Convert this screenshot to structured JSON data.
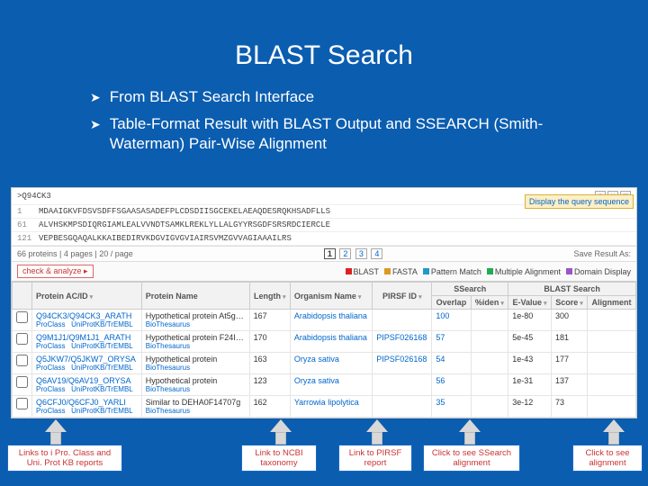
{
  "title": "BLAST Search",
  "bullets": [
    "From BLAST Search Interface",
    "Table-Format Result with BLAST Output and SSEARCH (Smith-Waterman) Pair-Wise Alignment"
  ],
  "seq": {
    "header": ">Q94CK3",
    "rows": [
      {
        "n": "1",
        "s": "MDAAIGKVFDSVSDFFSGAASASADEFPLCDSDIISGCEKELAEAQDESRQKHSADFLLS"
      },
      {
        "n": "61",
        "s": "ALVHSKMPSDIQRGIAMLEALVVNDTSAMKLREKLYLLALGYYRSGDFSRSRDCIERCLE"
      },
      {
        "n": "121",
        "s": "VEPBESGQAQALKKAIBEDIRVKDGVIGVGVIAIRSVMZGVVAGIAAAILRS"
      }
    ]
  },
  "pager": {
    "summary": "66 proteins | 4 pages | 20 / page",
    "pages": [
      "1",
      "2",
      "3",
      "4"
    ],
    "save": "Save Result As:"
  },
  "action": {
    "check": "check & analyze ▸",
    "legend": [
      {
        "c": "#d22",
        "t": "BLAST"
      },
      {
        "c": "#d92",
        "t": "FASTA"
      },
      {
        "c": "#29c",
        "t": "Pattern Match"
      },
      {
        "c": "#2a5",
        "t": "Multiple Alignment"
      },
      {
        "c": "#95c",
        "t": "Domain Display"
      }
    ]
  },
  "columns": {
    "acid": "Protein AC/ID",
    "pname": "Protein Name",
    "len": "Length",
    "org": "Organism Name",
    "pirsf": "PIRSF ID",
    "ss_group": "SSearch",
    "bl_group": "BLAST Search",
    "overlap": "Overlap",
    "pct": "%iden",
    "ev": "E-Value",
    "score": "Score",
    "aln": "Alignment"
  },
  "sublinks": {
    "pro": "ProClass",
    "up": "UniProtKB/TrEMBL",
    "bio": "BioThesaurus"
  },
  "rows": [
    {
      "ac": "Q94CK3/Q94CK3_ARATH",
      "pn": "Hypothetical protein At5g…",
      "len": "167",
      "org": "Arabidopsis thaliana",
      "pirsf": "",
      "ov": "100",
      "pct": "",
      "ev": "1e-80",
      "sc": "300",
      "al": ""
    },
    {
      "ac": "Q9M1J1/Q9M1J1_ARATH",
      "pn": "Hypothetical protein F24I…",
      "len": "170",
      "org": "Arabidopsis thaliana",
      "pirsf": "PIPSF026168",
      "ov": "57",
      "pct": "",
      "ev": "5e-45",
      "sc": "181",
      "al": ""
    },
    {
      "ac": "Q5JKW7/Q5JKW7_ORYSA",
      "pn": "Hypothetical protein",
      "len": "163",
      "org": "Oryza sativa",
      "pirsf": "PIPSF026168",
      "ov": "54",
      "pct": "",
      "ev": "1e-43",
      "sc": "177",
      "al": ""
    },
    {
      "ac": "Q6AV19/Q6AV19_ORYSA",
      "pn": "Hypothetical protein",
      "len": "123",
      "org": "Oryza sativa",
      "pirsf": "",
      "ov": "56",
      "pct": "",
      "ev": "1e-31",
      "sc": "137",
      "al": ""
    },
    {
      "ac": "Q6CFJ0/Q6CFJ0_YARLI",
      "pn": "Similar to DEHA0F14707g",
      "len": "162",
      "org": "Yarrowia lipolytica",
      "pirsf": "",
      "ov": "35",
      "pct": "",
      "ev": "3e-12",
      "sc": "73",
      "al": ""
    }
  ],
  "callouts": {
    "dq": "Display the query sequence",
    "c1": "Links to i Pro. Class and Uni. Prot KB reports",
    "c2": "Link to NCBI taxonomy",
    "c3": "Link to PIRSF report",
    "c4": "Click to see SSearch alignment",
    "c5": "Click to see alignment"
  }
}
